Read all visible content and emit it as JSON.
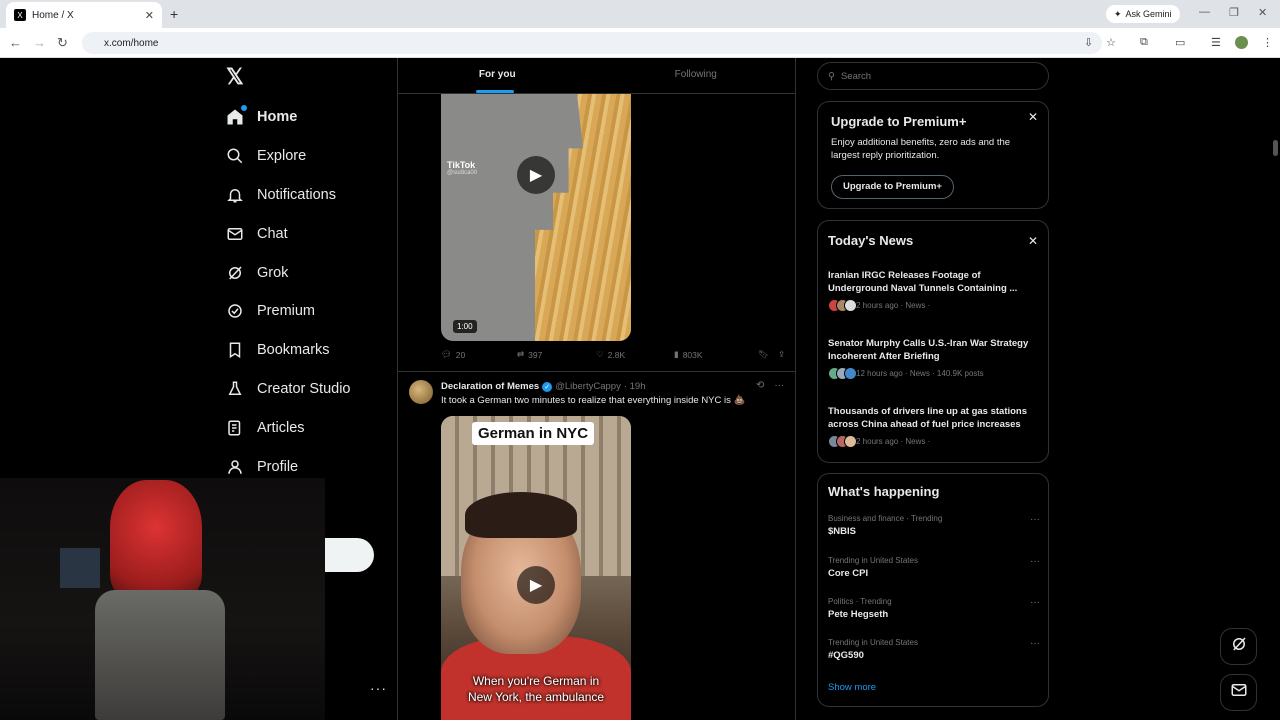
{
  "browser": {
    "tab_title": "Home / X",
    "tab_favicon": "X",
    "ask_gemini": "Ask Gemini",
    "url": "x.com/home"
  },
  "logo": "𝕏",
  "nav": [
    {
      "label": "Home",
      "icon": "home-icon",
      "active": true
    },
    {
      "label": "Explore",
      "icon": "search-icon"
    },
    {
      "label": "Notifications",
      "icon": "bell-icon"
    },
    {
      "label": "Chat",
      "icon": "mail-icon"
    },
    {
      "label": "Grok",
      "icon": "grok-icon"
    },
    {
      "label": "Premium",
      "icon": "premium-icon"
    },
    {
      "label": "Bookmarks",
      "icon": "bookmark-icon"
    },
    {
      "label": "Creator Studio",
      "icon": "flask-icon"
    },
    {
      "label": "Articles",
      "icon": "article-icon"
    },
    {
      "label": "Profile",
      "icon": "person-icon"
    }
  ],
  "account_more": "···",
  "timeline": {
    "tabs": [
      "For you",
      "Following"
    ],
    "post1": {
      "tiktok_label": "TikTok",
      "tiktok_handle": "@sudica00",
      "duration": "1:00",
      "replies": "20",
      "reposts": "397",
      "likes": "2.8K",
      "views": "803K"
    },
    "post2": {
      "name": "Declaration of Memes",
      "handle": "@LibertyCappy",
      "time": "· 19h",
      "text": "It took a German two minutes to realize that everything inside NYC is 💩",
      "video_caption": "German in NYC",
      "subtitle_line1": "When you're German in",
      "subtitle_line2": "New York, the ambulance"
    }
  },
  "search": {
    "placeholder": "Search"
  },
  "premium": {
    "title": "Upgrade to Premium+",
    "body": "Enjoy additional benefits, zero ads and the largest reply prioritization.",
    "button": "Upgrade to Premium+"
  },
  "news": {
    "title": "Today's News",
    "items": [
      {
        "headline": "Iranian IRGC Releases Footage of Underground Naval Tunnels Containing ...",
        "meta": "2 hours ago · News ·"
      },
      {
        "headline": "Senator Murphy Calls U.S.-Iran War Strategy Incoherent After Briefing",
        "meta": "12 hours ago · News · 140.9K posts"
      },
      {
        "headline": "Thousands of drivers line up at gas stations across China ahead of fuel price increases",
        "meta": "2 hours ago · News ·"
      }
    ]
  },
  "happening": {
    "title": "What's happening",
    "trends": [
      {
        "context": "Business and finance · Trending",
        "name": "$NBIS"
      },
      {
        "context": "Trending in United States",
        "name": "Core CPI"
      },
      {
        "context": "Politics · Trending",
        "name": "Pete Hegseth"
      },
      {
        "context": "Trending in United States",
        "name": "#QG590"
      }
    ],
    "show_more": "Show more"
  },
  "colors": {
    "accent": "#1d9bf0",
    "background": "#000000",
    "border": "#2f3336",
    "muted": "#71767b"
  }
}
